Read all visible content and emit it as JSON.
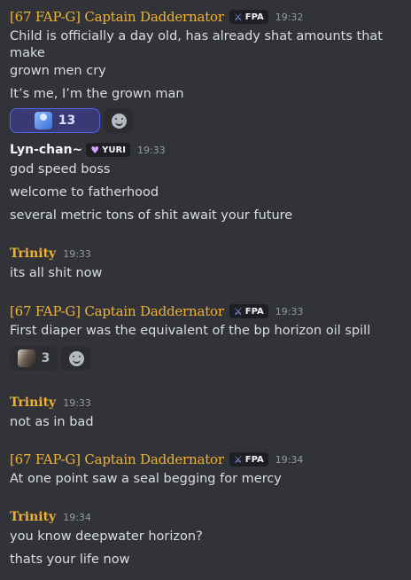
{
  "messages": [
    {
      "author": "[67 FAP-G] Captain Daddernator",
      "tag": "FPA",
      "time": "19:32",
      "lines": [
        "Child is officially a day old, has already shat amounts that make",
        "grown men cry",
        "It’s me, I’m the grown man"
      ],
      "reaction_count": "13"
    },
    {
      "author": "Lyn-chan~",
      "tag": "YURI",
      "time": "19:33",
      "lines": [
        "god speed boss",
        "welcome to fatherhood",
        "several metric tons of shit await your future"
      ]
    },
    {
      "author": "Trinity",
      "time": "19:33",
      "lines": [
        "its all shit now"
      ]
    },
    {
      "author": "[67 FAP-G] Captain Daddernator",
      "tag": "FPA",
      "time": "19:33",
      "lines": [
        "First diaper was the equivalent of the bp horizon oil spill"
      ],
      "reaction_count": "3"
    },
    {
      "author": "Trinity",
      "time": "19:33",
      "lines": [
        "not as in bad"
      ]
    },
    {
      "author": "[67 FAP-G] Captain Daddernator",
      "tag": "FPA",
      "time": "19:34",
      "lines": [
        "At one point saw a seal begging for mercy"
      ]
    },
    {
      "author": "Trinity",
      "time": "19:34",
      "lines": [
        "you know deepwater horizon?",
        "thats your life now"
      ]
    }
  ],
  "colors": {
    "background": "#313338",
    "gold_name": "#f0b232",
    "text": "#dbdee1",
    "timestamp": "#949ba4"
  },
  "icons": {
    "fpa_tag": "sword-icon",
    "yuri_tag": "heart-icon",
    "add_reaction": "smiley-icon"
  }
}
